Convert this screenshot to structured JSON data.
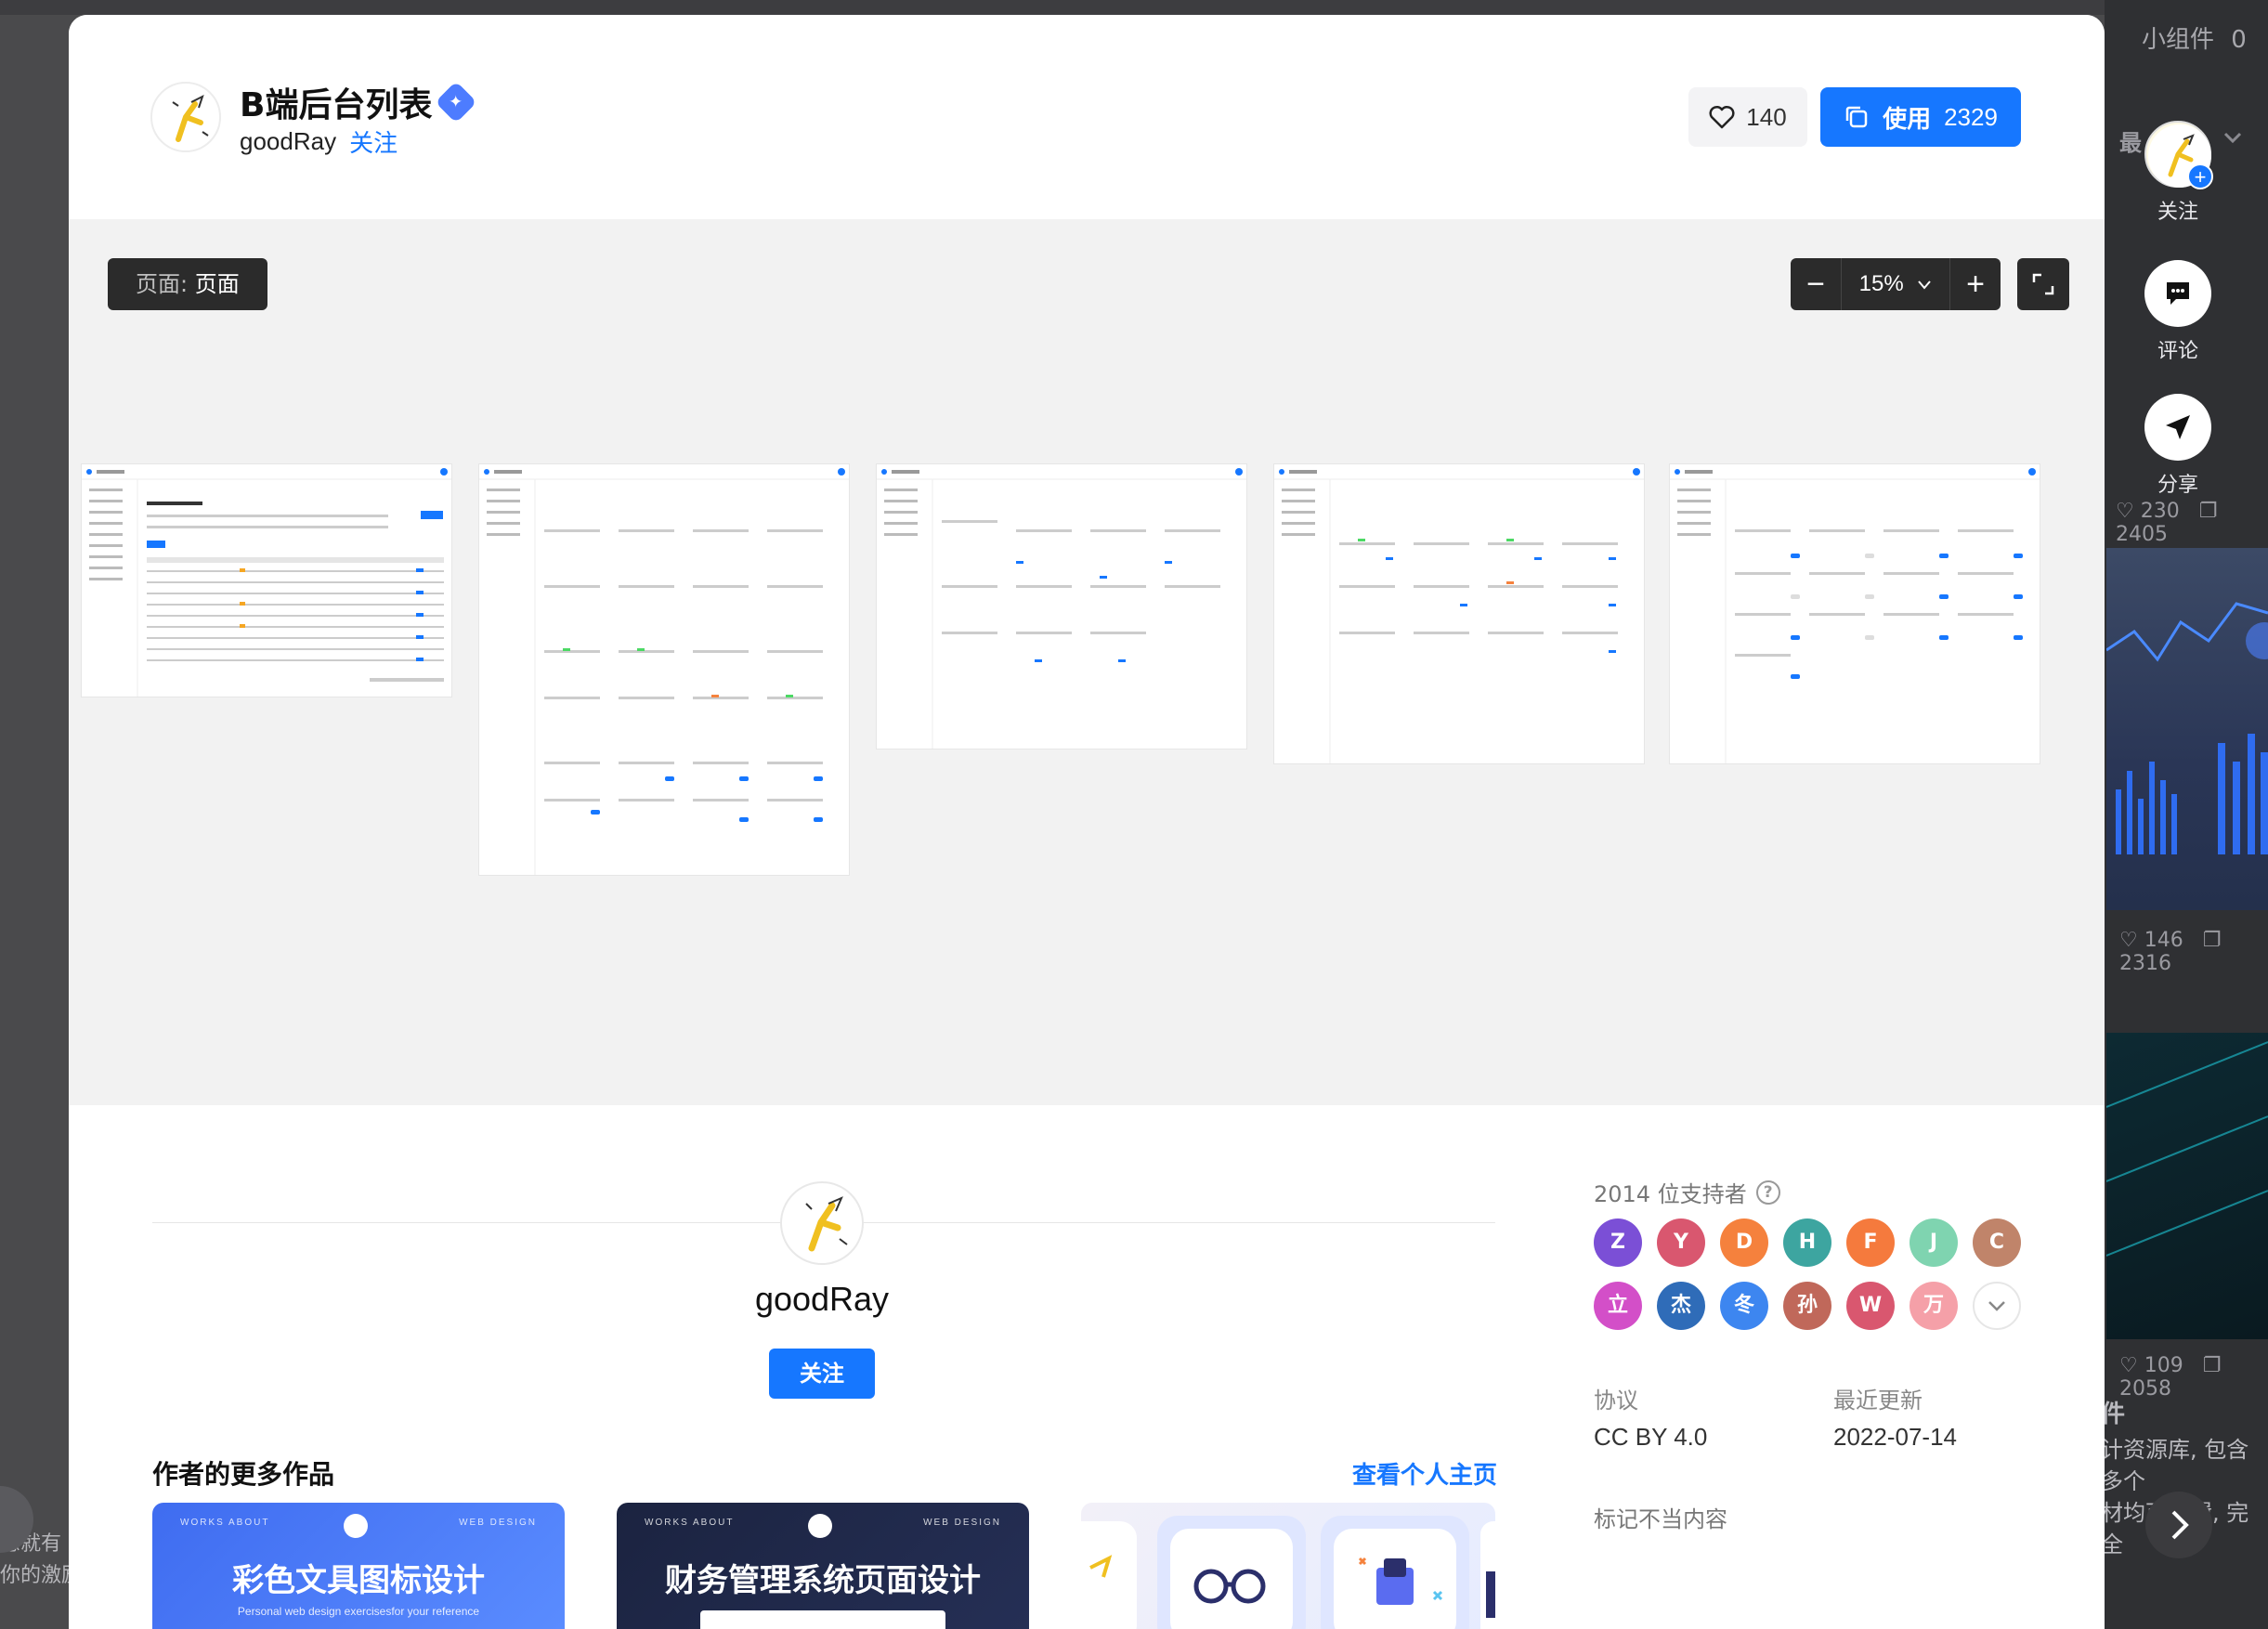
{
  "background": {
    "widget_label": "小组件",
    "widget_count": "0",
    "latest_label": "最",
    "card1_stats": {
      "likes": "230",
      "uses": "2405"
    },
    "card2_stats": {
      "likes": "146",
      "uses": "2316"
    },
    "card3_stats": {
      "likes": "109",
      "uses": "2058"
    },
    "right_text_lines": [
      "件",
      "计资源库, 包含多个",
      "材均可编辑, 完全"
    ],
    "left_text_lines": [
      "愿就有",
      "你的激励"
    ]
  },
  "side_actions": {
    "follow_label": "关注",
    "comment_label": "评论",
    "share_label": "分享"
  },
  "header": {
    "title": "B端后台列表",
    "author": "goodRay",
    "follow": "关注",
    "likes": "140",
    "use_label": "使用",
    "use_count": "2329"
  },
  "canvas": {
    "page_label": "页面:",
    "page_value": "页面",
    "zoom": "15%",
    "zoom_out": "−",
    "zoom_in": "+"
  },
  "author_section": {
    "name": "goodRay",
    "follow": "关注",
    "more_title": "作者的更多作品",
    "view_profile": "查看个人主页",
    "works": [
      {
        "title": "彩色文具图标设计",
        "subtitle": "Personal web design exercisesfor your reference",
        "nav_left": "WORKS    ABOUT",
        "nav_right": "WEB    DESIGN"
      },
      {
        "title": "财务管理系统页面设计",
        "subtitle": "",
        "nav_left": "WORKS    ABOUT",
        "nav_right": "WEB    DESIGN"
      }
    ]
  },
  "info": {
    "supporters_label": "2014 位支持者",
    "supporters": [
      {
        "initial": "Z",
        "color": "#7b4fd6"
      },
      {
        "initial": "Y",
        "color": "#d9576f"
      },
      {
        "initial": "D",
        "color": "#f5813d"
      },
      {
        "initial": "H",
        "color": "#3da5a0"
      },
      {
        "initial": "F",
        "color": "#f57a3d"
      },
      {
        "initial": "J",
        "color": "#7fd4b0"
      },
      {
        "initial": "C",
        "color": "#c0846a"
      },
      {
        "initial": "立",
        "color": "#d34fc8"
      },
      {
        "initial": "杰",
        "color": "#2f6cb8"
      },
      {
        "initial": "冬",
        "color": "#3d86f0"
      },
      {
        "initial": "孙",
        "color": "#c0685a"
      },
      {
        "initial": "W",
        "color": "#d9576f"
      },
      {
        "initial": "万",
        "color": "#f5a0a8"
      }
    ],
    "license_label": "协议",
    "license_value": "CC BY 4.0",
    "updated_label": "最近更新",
    "updated_value": "2022-07-14",
    "report": "标记不当内容"
  },
  "colors": {
    "accent": "#1677ff",
    "canvas_bg": "#f2f2f2",
    "dark_control": "#2b2b2b"
  }
}
